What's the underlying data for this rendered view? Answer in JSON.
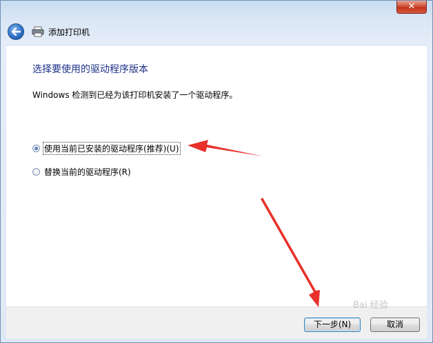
{
  "window": {
    "close_label": "✕"
  },
  "nav": {
    "title": "添加打印机"
  },
  "page": {
    "heading": "选择要使用的驱动程序版本",
    "description": "Windows 检测到已经为该打印机安装了一个驱动程序。"
  },
  "options": [
    {
      "label": "使用当前已安装的驱动程序(推荐)(U)",
      "checked": true
    },
    {
      "label": "替换当前的驱动程序(R)",
      "checked": false
    }
  ],
  "buttons": {
    "next": "下一步(N)",
    "cancel": "取消"
  },
  "watermark": "Bai 经验",
  "colors": {
    "heading": "#1e3287",
    "arrow": "#e8312a",
    "close": "#c2331b"
  }
}
